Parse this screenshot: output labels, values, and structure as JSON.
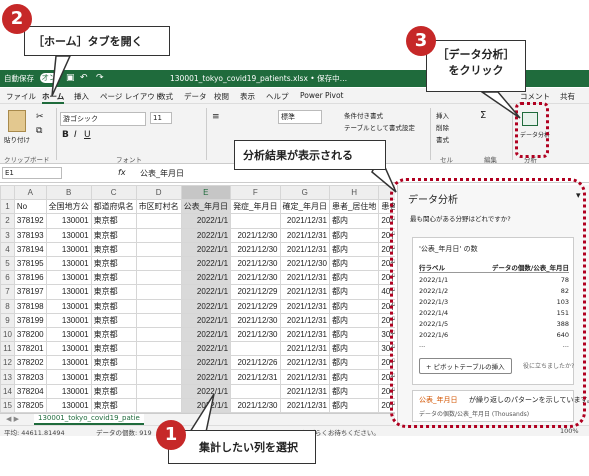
{
  "titlebar": {
    "autosave": "自動保存",
    "autosave_state": "オン",
    "filename": "130001_tokyo_covid19_patients.xlsx • 保存中…"
  },
  "menu": {
    "tabs": [
      "ファイル",
      "ホーム",
      "挿入",
      "ページ レイアウト",
      "数式",
      "データ",
      "校閲",
      "表示",
      "ヘルプ",
      "Power Pivot"
    ],
    "share": "共有",
    "comment": "コメント"
  },
  "ribbon": {
    "paste": "貼り付け",
    "clipboard": "クリップボード",
    "font_name": "游ゴシック",
    "font_size": "11",
    "font_group": "フォント",
    "number_format": "標準",
    "cond_format": "条件付き書式",
    "table_format": "テーブルとして書式設定",
    "insert": "挿入",
    "delete": "削除",
    "format": "書式",
    "cells_group": "セル",
    "edit_group": "編集",
    "analyze_label": "データ分析",
    "analyze_group": "分析",
    "sum_symbol": "Σ"
  },
  "formula": {
    "namebox": "E1",
    "fx": "fx",
    "content": "公表_年月日"
  },
  "grid": {
    "columns": [
      "A",
      "B",
      "C",
      "D",
      "E",
      "F",
      "G",
      "H",
      "I"
    ],
    "header_row": [
      "No",
      "全国地方公",
      "都道府県名",
      "市区町村名",
      "公表_年月日",
      "発症_年月日",
      "確定_年月日",
      "患者_居住地",
      "患者_年"
    ],
    "rows": [
      [
        "378192",
        "130001",
        "東京都",
        "",
        "2022/1/1",
        "",
        "2021/12/31",
        "都内",
        "20代"
      ],
      [
        "378193",
        "130001",
        "東京都",
        "",
        "2022/1/1",
        "2021/12/30",
        "2021/12/31",
        "都内",
        "20代"
      ],
      [
        "378194",
        "130001",
        "東京都",
        "",
        "2022/1/1",
        "2021/12/30",
        "2021/12/31",
        "都内",
        "20代"
      ],
      [
        "378195",
        "130001",
        "東京都",
        "",
        "2022/1/1",
        "2021/12/30",
        "2021/12/30",
        "都内",
        "20代"
      ],
      [
        "378196",
        "130001",
        "東京都",
        "",
        "2022/1/1",
        "2021/12/30",
        "2021/12/31",
        "都内",
        "20代"
      ],
      [
        "378197",
        "130001",
        "東京都",
        "",
        "2022/1/1",
        "2021/12/29",
        "2021/12/31",
        "都内",
        "40代"
      ],
      [
        "378198",
        "130001",
        "東京都",
        "",
        "2022/1/1",
        "2021/12/29",
        "2021/12/31",
        "都内",
        "20代"
      ],
      [
        "378199",
        "130001",
        "東京都",
        "",
        "2022/1/1",
        "2021/12/30",
        "2021/12/31",
        "都内",
        "20代"
      ],
      [
        "378200",
        "130001",
        "東京都",
        "",
        "2022/1/1",
        "2021/12/30",
        "2021/12/31",
        "都内",
        "30代"
      ],
      [
        "378201",
        "130001",
        "東京都",
        "",
        "2022/1/1",
        "",
        "2021/12/31",
        "都内",
        "30代"
      ],
      [
        "378202",
        "130001",
        "東京都",
        "",
        "2022/1/1",
        "2021/12/26",
        "2021/12/31",
        "都内",
        "20代"
      ],
      [
        "378203",
        "130001",
        "東京都",
        "",
        "2022/1/1",
        "2021/12/31",
        "2021/12/31",
        "都内",
        "20代"
      ],
      [
        "378204",
        "130001",
        "東京都",
        "",
        "2022/1/1",
        "",
        "2021/12/31",
        "都内",
        "20代"
      ],
      [
        "378205",
        "130001",
        "東京都",
        "",
        "2022/1/1",
        "2021/12/30",
        "2021/12/31",
        "都内",
        "20代"
      ],
      [
        "378206",
        "130001",
        "東京都",
        "",
        "2022/1/1",
        "2021/12/31",
        "2021/12/31",
        "都内",
        "20代"
      ]
    ]
  },
  "sheet_tab": "130001_tokyo_covid19_patie",
  "status": {
    "avg": "平均: 44611.81494",
    "count": "データの個数: 919",
    "notice": "ています。しばらくお待ちください。",
    "zoom": "100%"
  },
  "panel": {
    "title": "データ分析",
    "question": "最も関心がある分野はどれですか?",
    "card_title": "'公表_年月日' の数",
    "col_label": "行ラベル",
    "col_count": "データの個数/公表_年月日",
    "rows": [
      [
        "2022/1/1",
        "78"
      ],
      [
        "2022/1/2",
        "82"
      ],
      [
        "2022/1/3",
        "103"
      ],
      [
        "2022/1/4",
        "151"
      ],
      [
        "2022/1/5",
        "388"
      ],
      [
        "2022/1/6",
        "640"
      ]
    ],
    "more": "...",
    "more_right": "...",
    "pivot_button": "+ ピボットテーブルの挿入",
    "helpful": "役に立ちましたか?",
    "insight_key": "公表_年月日",
    "insight_text": "が繰り返しのパターンを示しています。",
    "insight_sub": "データの個数/公表_年月日 (Thousands)"
  },
  "callouts": {
    "c1_text": "集計したい列を選択",
    "c1_num": "1",
    "c2_text": "［ホーム］タブを開く",
    "c2_num": "2",
    "c3_text1": "［データ分析］",
    "c3_text2": "をクリック",
    "c3_num": "3",
    "result": "分析結果が表示される"
  },
  "colors": {
    "excel_green": "#1f6b3c",
    "callout_red": "#c62828",
    "accent_orange": "#d35400"
  }
}
